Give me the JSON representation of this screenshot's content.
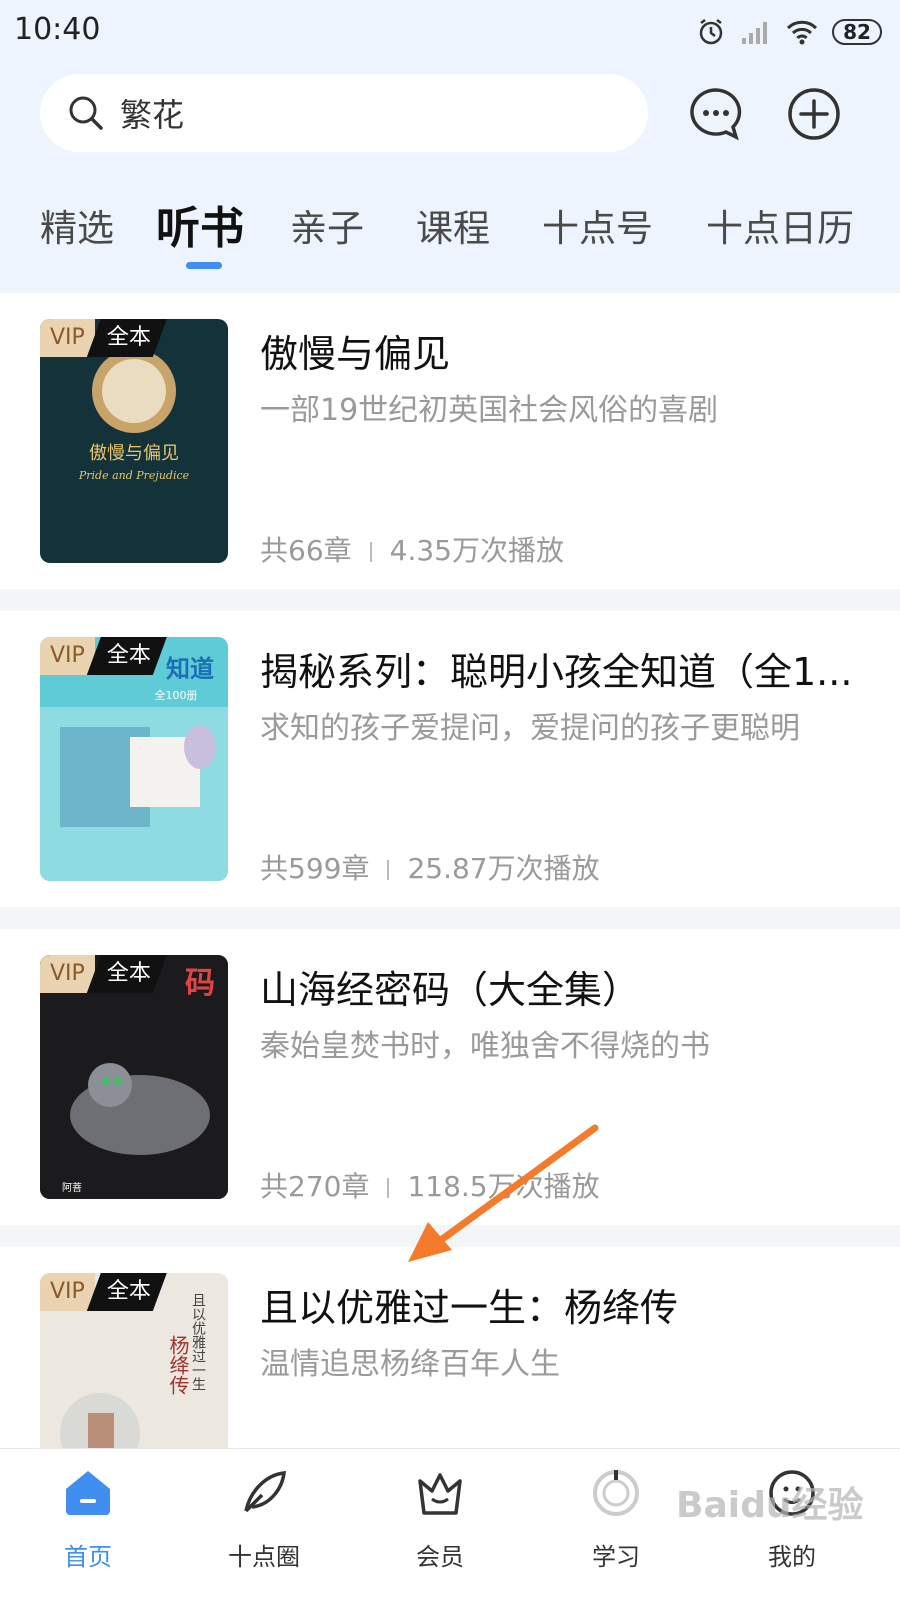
{
  "status_bar": {
    "time": "10:40",
    "battery": "82"
  },
  "search": {
    "placeholder": "繁花"
  },
  "tabs": [
    {
      "label": "精选",
      "active": false
    },
    {
      "label": "听书",
      "active": true
    },
    {
      "label": "亲子",
      "active": false
    },
    {
      "label": "课程",
      "active": false
    },
    {
      "label": "十点号",
      "active": false
    },
    {
      "label": "十点日历",
      "active": false
    }
  ],
  "badges": {
    "vip": "VIP",
    "full": "全本"
  },
  "books": [
    {
      "title": "傲慢与偏见",
      "desc": "一部19世纪初英国社会风俗的喜剧",
      "chapters": "共66章",
      "plays": "4.35万次播放",
      "cover_title": "傲慢与偏见",
      "cover_sub": "Pride and Prejudice",
      "cover_color": "#14323a"
    },
    {
      "title": "揭秘系列：聪明小孩全知道（全1...",
      "desc": "求知的孩子爱提问，爱提问的孩子更聪明",
      "chapters": "共599章",
      "plays": "25.87万次播放",
      "cover_title": "知道",
      "cover_sub": "全100册",
      "cover_color": "#5ecbd6"
    },
    {
      "title": "山海经密码（大全集）",
      "desc": "秦始皇焚书时，唯独舍不得烧的书",
      "chapters": "共270章",
      "plays": "118.5万次播放",
      "cover_title": "码",
      "cover_sub": "阿菩",
      "cover_color": "#222222"
    },
    {
      "title": "且以优雅过一生：杨绛传",
      "desc": "温情追思杨绛百年人生",
      "chapters": "",
      "plays": "",
      "cover_title": "杨绛传",
      "cover_sub": "且以优雅过一生",
      "cover_color": "#ece7df"
    }
  ],
  "bottom_nav": [
    {
      "label": "首页",
      "icon": "home-icon",
      "active": true
    },
    {
      "label": "十点圈",
      "icon": "feather-icon",
      "active": false
    },
    {
      "label": "会员",
      "icon": "crown-icon",
      "active": false
    },
    {
      "label": "学习",
      "icon": "study-icon",
      "active": false
    },
    {
      "label": "我的",
      "icon": "profile-icon",
      "active": false
    }
  ],
  "watermark": "Baidu经验",
  "colors": {
    "accent": "#3f8ef0",
    "annotation_arrow": "#f47a2c"
  }
}
